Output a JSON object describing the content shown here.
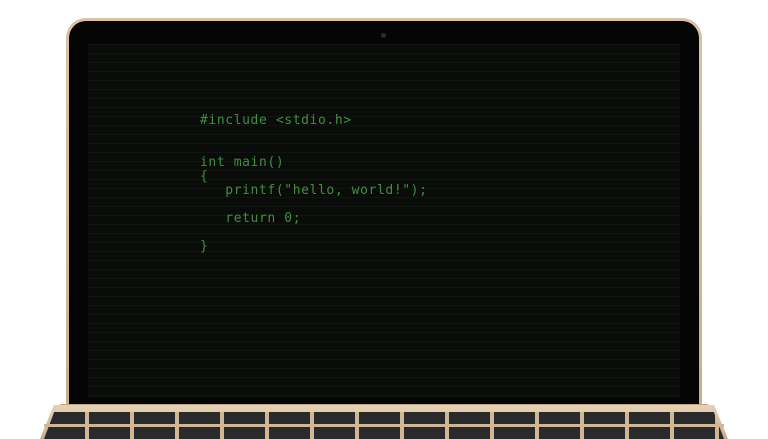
{
  "screen": {
    "code_lines": [
      "#include <stdio.h>",
      "",
      "",
      "int main()",
      "{",
      "   printf(\"hello, world!\");",
      "",
      "   return 0;",
      "",
      "}"
    ]
  },
  "colors": {
    "code_text": "#3f8f3f",
    "screen_background": "#0a0c0a",
    "laptop_body": "#d9c3a5",
    "keys": "#2a2a2c"
  }
}
